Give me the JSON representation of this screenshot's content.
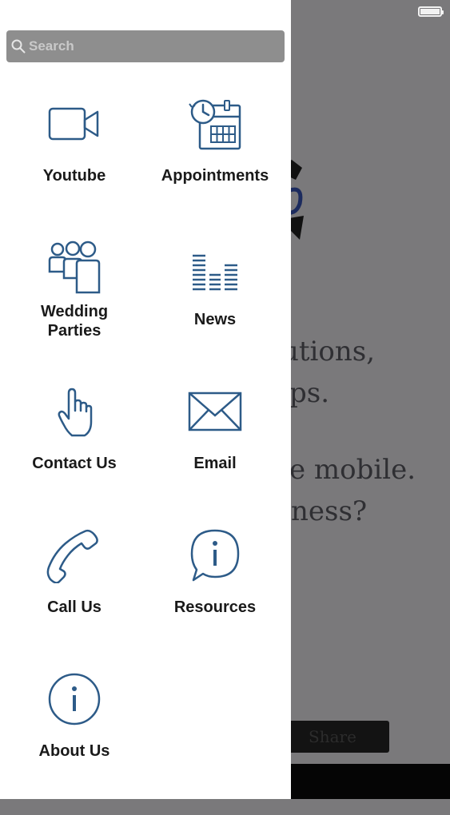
{
  "search": {
    "placeholder": "Search"
  },
  "menu": [
    {
      "label": "Youtube",
      "icon": "video-camera-icon"
    },
    {
      "label": "Appointments",
      "icon": "calendar-clock-icon"
    },
    {
      "label": "Wedding\nParties",
      "icon": "group-people-icon"
    },
    {
      "label": "News",
      "icon": "equalizer-bars-icon"
    },
    {
      "label": "Contact Us",
      "icon": "pointing-hand-icon"
    },
    {
      "label": "Email",
      "icon": "envelope-icon"
    },
    {
      "label": "Call Us",
      "icon": "phone-handset-icon"
    },
    {
      "label": "Resources",
      "icon": "info-speech-bubble-icon"
    },
    {
      "label": "About Us",
      "icon": "info-circle-icon"
    }
  ],
  "background": {
    "text_lines": [
      "utions,",
      "ps.",
      "e mobile.",
      "ness?"
    ],
    "share_label": "Share"
  },
  "colors": {
    "icon_stroke": "#2d5b88",
    "drawer": "#ffffff",
    "overlay": "#7a797b"
  }
}
